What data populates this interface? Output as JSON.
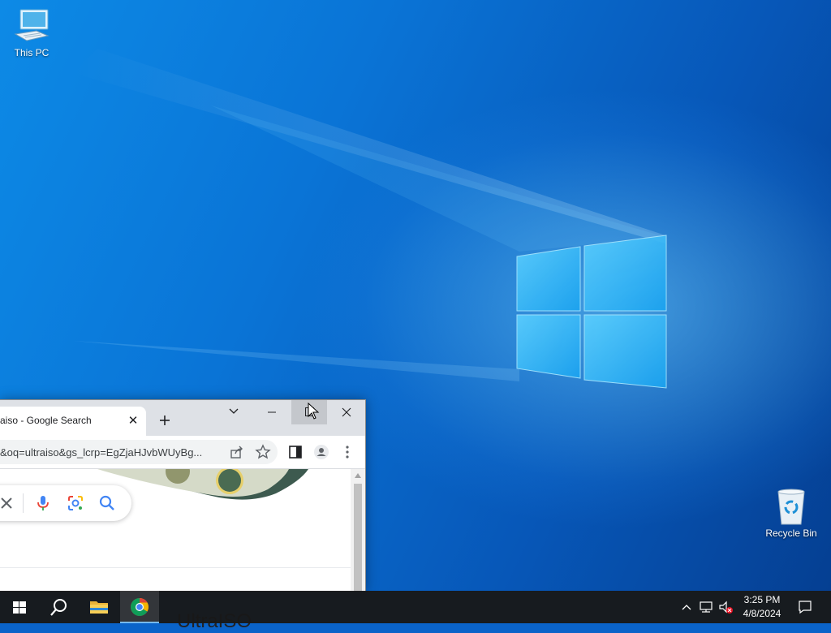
{
  "desktop": {
    "icons": [
      {
        "label": "This PC",
        "icon": "computer-icon"
      },
      {
        "label": "Recycle Bin",
        "icon": "recycle-bin-icon"
      }
    ]
  },
  "browser": {
    "tab": {
      "title": "aiso - Google Search",
      "close_glyph": "✕"
    },
    "new_tab_icon": "plus-icon",
    "window_controls": [
      "chevron-down-icon",
      "minimize-icon",
      "maximize-icon",
      "close-icon"
    ],
    "address_bar": {
      "url": "&oq=ultraiso&gs_lcrp=EgZjaHJvbWUyBg..."
    },
    "toolbar_icons": [
      "share-icon",
      "star-icon",
      "side-panel-icon",
      "profile-icon",
      "menu-icon"
    ],
    "search_box_icons": [
      "clear-icon",
      "mic-icon",
      "lens-icon",
      "search-icon"
    ],
    "peek_result_text": "UltraISO"
  },
  "taskbar": {
    "items": [
      "start-icon",
      "search-icon",
      "file-explorer-icon",
      "chrome-icon"
    ],
    "active_item": "chrome-icon",
    "tray_icons": [
      "chevron-up-icon",
      "network-icon",
      "volume-muted-icon"
    ],
    "clock": {
      "time": "3:25 PM",
      "date": "4/8/2024"
    },
    "notifications_icon": "action-center-icon"
  },
  "colors": {
    "accent": "#0078d7",
    "taskbar": "#181818",
    "tab_strip": "#dee1e6"
  }
}
